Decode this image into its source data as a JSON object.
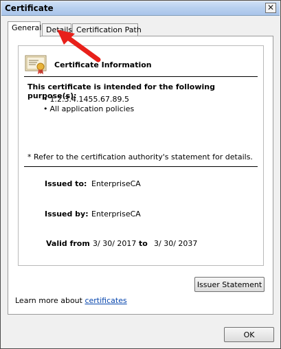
{
  "window": {
    "title": "Certificate",
    "close_glyph": "✕"
  },
  "tabs": [
    {
      "label": "General",
      "active": true
    },
    {
      "label": "Details",
      "active": false
    },
    {
      "label": "Certification Path",
      "active": false
    }
  ],
  "info": {
    "icon": "certificate-icon",
    "title": "Certificate Information",
    "purpose_heading": "This certificate is intended for the following purpose(s):",
    "purposes": [
      "1.2.3.4.1455.67.89.5",
      "All application policies"
    ],
    "refer_note": "* Refer to the certification authority's statement for details.",
    "issued_to_label": "Issued to:",
    "issued_to_value": "EnterpriseCA",
    "issued_by_label": "Issued by:",
    "issued_by_value": "EnterpriseCA",
    "valid_from_label": "Valid from",
    "valid_from_value": "3/ 30/ 2017",
    "valid_to_label": "to",
    "valid_to_value": "3/ 30/ 2037"
  },
  "buttons": {
    "issuer_statement": "Issuer Statement",
    "ok": "OK"
  },
  "learn_more": {
    "prefix": "Learn more about ",
    "link": "certificates"
  },
  "annotation": {
    "arrow_color": "#e8201a",
    "arrow_target": "Details"
  }
}
